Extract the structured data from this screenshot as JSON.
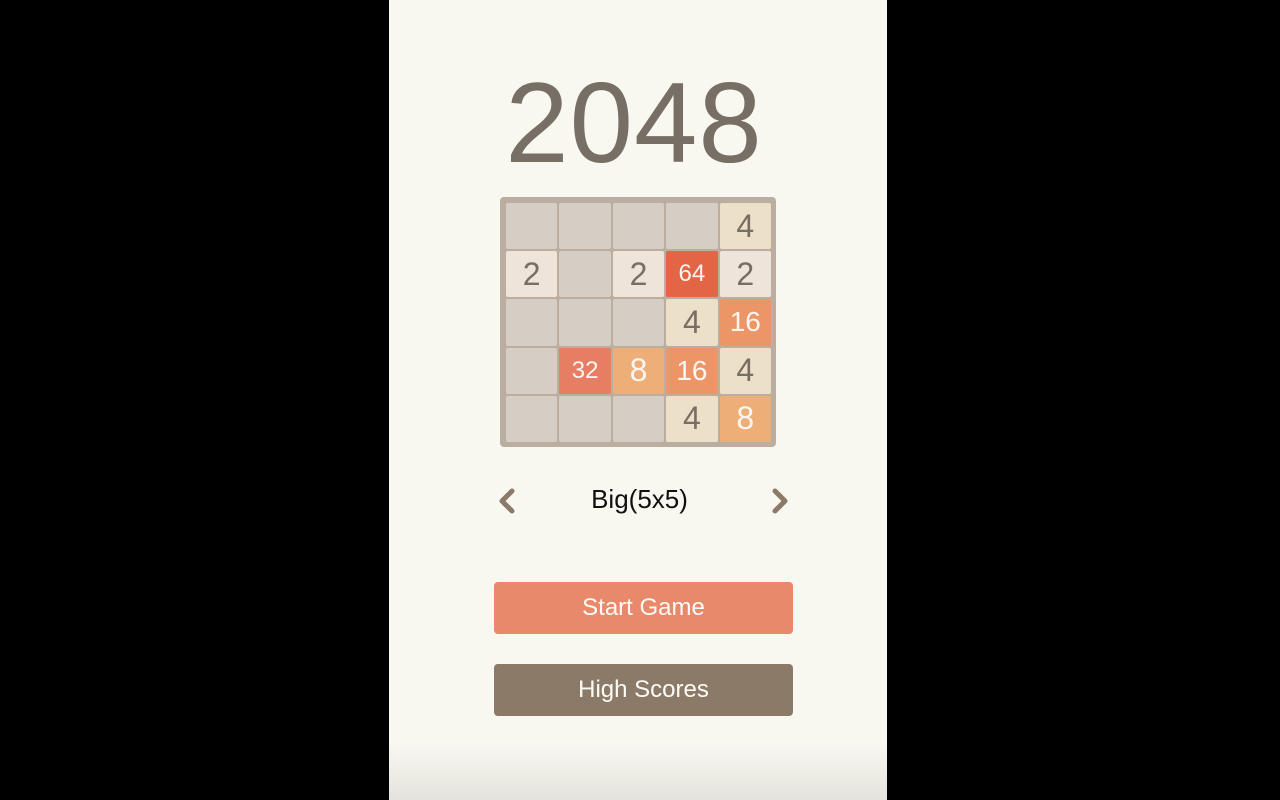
{
  "app": {
    "title": "2048"
  },
  "board": {
    "size": 5,
    "rows": [
      [
        null,
        null,
        null,
        null,
        4
      ],
      [
        2,
        null,
        2,
        64,
        2
      ],
      [
        null,
        null,
        null,
        4,
        16
      ],
      [
        null,
        32,
        8,
        16,
        4
      ],
      [
        null,
        null,
        null,
        4,
        8
      ]
    ]
  },
  "mode_selector": {
    "label": "Big(5x5)",
    "prev_icon": "chevron-left-icon",
    "next_icon": "chevron-right-icon",
    "arrow_color": "#8c7a68"
  },
  "buttons": {
    "start_game": "Start Game",
    "high_scores": "High Scores"
  },
  "colors": {
    "background": "#f8f7f0",
    "title": "#776e65",
    "board": "#bbada0",
    "empty_cell": "#d6cdc4",
    "start_button": "#e8896b",
    "high_scores_button": "#8c7a68"
  }
}
